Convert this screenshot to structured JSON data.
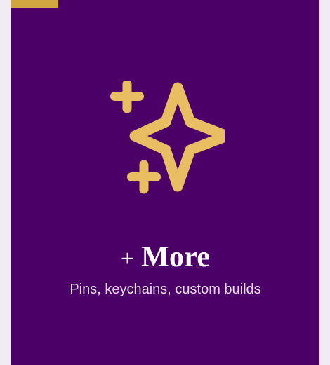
{
  "card": {
    "title_prefix": "+",
    "title_word": "More",
    "subtitle": "Pins, keychains, custom builds",
    "icon": "sparkle-icon"
  },
  "colors": {
    "card_background": "#4b0068",
    "accent": "#d2a63f",
    "icon": "#e9bd62",
    "title": "#ffffff",
    "subtitle": "#e7dced"
  }
}
